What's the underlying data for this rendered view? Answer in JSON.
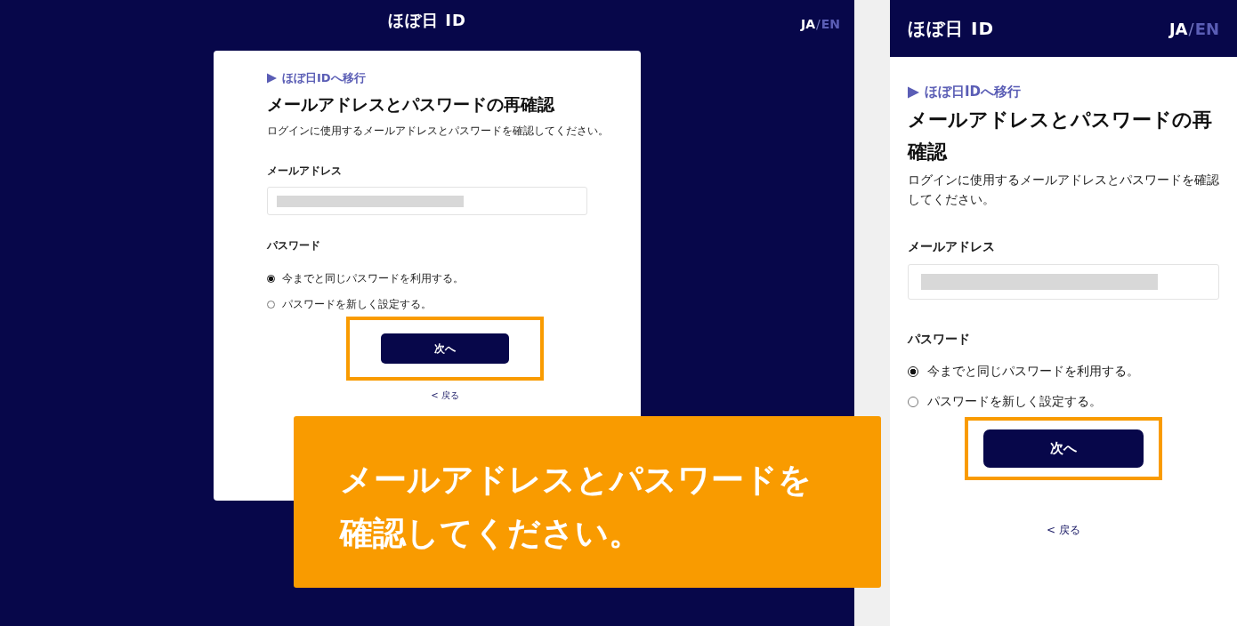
{
  "views": [
    {
      "kind": "desktop",
      "logo": "ほぼ日 ID",
      "languages": [
        {
          "label": "JA",
          "selected": true
        },
        {
          "label": "EN",
          "selected": false
        }
      ],
      "language_separator": "/",
      "breadcrumb": "ほぼ日IDへ移行",
      "title": "メールアドレスとパスワードの再確認",
      "description": "ログインに使用するメールアドレスとパスワードを確認してください。",
      "email_label": "メールアドレス",
      "password_label": "パスワード",
      "password_options": [
        {
          "label": "今までと同じパスワードを利用する。",
          "selected": true
        },
        {
          "label": "パスワードを新しく設定する。",
          "selected": false
        }
      ],
      "next_button": {
        "label": "次へ",
        "highlighted": true
      },
      "back_link": "< 戻る"
    },
    {
      "kind": "mobile",
      "logo": "ほぼ日 ID",
      "languages": [
        {
          "label": "JA",
          "selected": true
        },
        {
          "label": "EN",
          "selected": false
        }
      ],
      "language_separator": "/",
      "breadcrumb": "ほぼ日IDへ移行",
      "title": "メールアドレスとパスワードの再確認",
      "description": "ログインに使用するメールアドレスとパスワードを確認してください。",
      "email_label": "メールアドレス",
      "password_label": "パスワード",
      "password_options": [
        {
          "label": "今までと同じパスワードを利用する。",
          "selected": true
        },
        {
          "label": "パスワードを新しく設定する。",
          "selected": false
        }
      ],
      "next_button": {
        "label": "次へ",
        "highlighted": true
      },
      "back_link": "< 戻る"
    }
  ],
  "callout": {
    "text": "メールアドレスとパスワードを確認してください。"
  }
}
